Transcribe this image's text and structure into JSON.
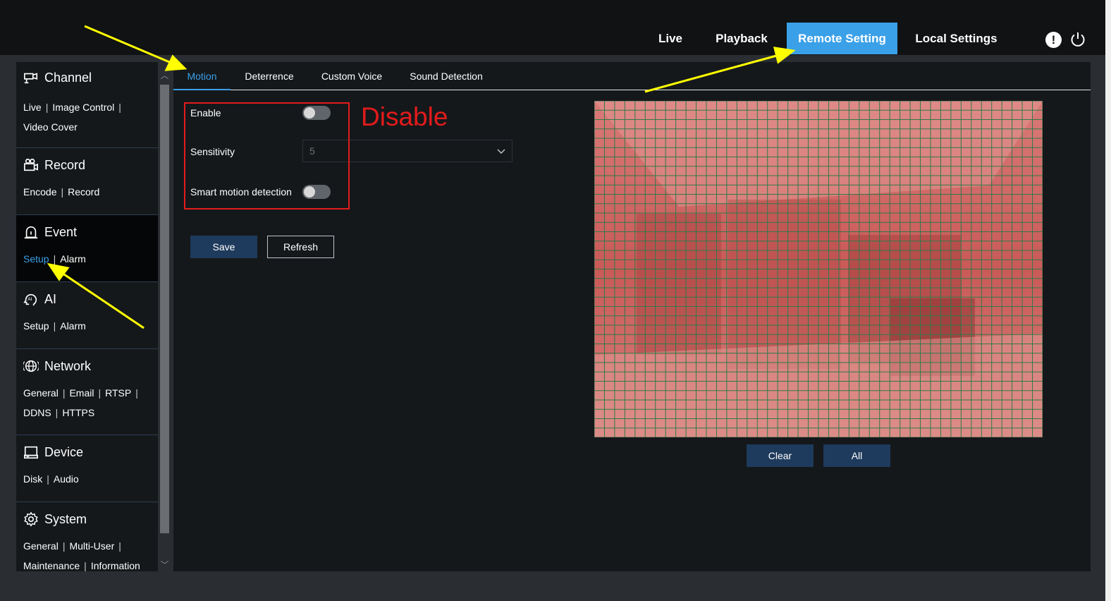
{
  "topnav": {
    "items": [
      {
        "label": "Live"
      },
      {
        "label": "Playback"
      },
      {
        "label": "Remote Setting",
        "active": true
      },
      {
        "label": "Local Settings"
      }
    ],
    "alert_icon": "exclamation-icon",
    "alert_glyph": "!",
    "power_icon": "power-icon"
  },
  "sidebar": {
    "channel": {
      "title": "Channel",
      "icon": "camera-icon",
      "links": [
        "Live",
        "Image Control",
        "Video Cover"
      ]
    },
    "record": {
      "title": "Record",
      "icon": "record-icon",
      "links": [
        "Encode",
        "Record"
      ]
    },
    "event": {
      "title": "Event",
      "icon": "alarm-icon",
      "links": [
        "Setup",
        "Alarm"
      ],
      "active_link": "Setup"
    },
    "ai": {
      "title": "AI",
      "icon": "ai-icon",
      "links": [
        "Setup",
        "Alarm"
      ]
    },
    "network": {
      "title": "Network",
      "icon": "globe-icon",
      "links": [
        "General",
        "Email",
        "RTSP",
        "DDNS",
        "HTTPS"
      ]
    },
    "device": {
      "title": "Device",
      "icon": "hdd-icon",
      "links": [
        "Disk",
        "Audio"
      ]
    },
    "system": {
      "title": "System",
      "icon": "gear-icon",
      "links": [
        "General",
        "Multi-User",
        "Maintenance",
        "Information"
      ]
    },
    "separator": "|"
  },
  "tabs": [
    {
      "label": "Motion",
      "active": true
    },
    {
      "label": "Deterrence"
    },
    {
      "label": "Custom Voice"
    },
    {
      "label": "Sound Detection"
    }
  ],
  "form": {
    "enable_label": "Enable",
    "enable_on": false,
    "sensitivity_label": "Sensitivity",
    "sensitivity_value": "5",
    "smart_label": "Smart motion detection",
    "smart_on": false
  },
  "annotation": {
    "text": "Disable",
    "color": "#e31b1b"
  },
  "buttons": {
    "save": "Save",
    "refresh": "Refresh",
    "clear": "Clear",
    "all": "All"
  },
  "colors": {
    "accent": "#3aa0e8",
    "button": "#1e3a5c",
    "annotation_red": "#e31b1b",
    "arrow_yellow": "#ffff00"
  }
}
